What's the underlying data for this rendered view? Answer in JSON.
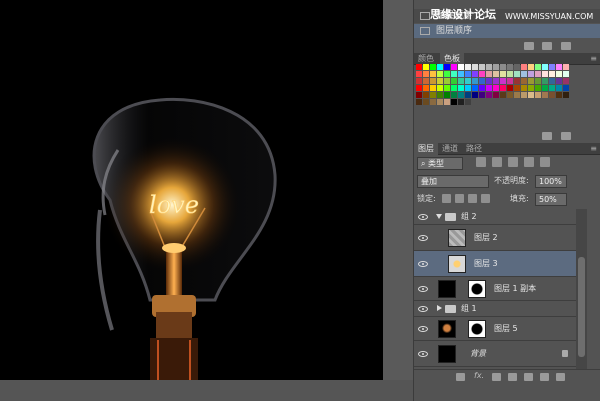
{
  "canvas": {
    "title_fragment": "",
    "bulb_text": "love"
  },
  "history_panel": {
    "items": [
      {
        "label": "图层顺序"
      },
      {
        "label": "图层顺序"
      }
    ],
    "watermark": "思缘设计论坛",
    "watermark_url": "WWW.MISSYUAN.COM"
  },
  "swatch_panel": {
    "tabs": [
      {
        "label": "颜色"
      },
      {
        "label": "色板"
      }
    ],
    "colors": [
      [
        "#ff0000",
        "#ffff00",
        "#00ff00",
        "#00ffff",
        "#0000ff",
        "#ff00ff",
        "#ffffff",
        "#f0f0f0",
        "#dcdcdc",
        "#c8c8c8",
        "#b4b4b4",
        "#a0a0a0",
        "#8c8c8c",
        "#787878",
        "#646464",
        "#ff8080",
        "#ffd080",
        "#80ff80",
        "#80ffff",
        "#8080ff",
        "#ff80ff",
        "#ffb0b0"
      ],
      [
        "#ff4040",
        "#ff8040",
        "#ffc040",
        "#c0ff40",
        "#40ff40",
        "#40ffc0",
        "#40c0ff",
        "#4080ff",
        "#8040ff",
        "#ff40c0",
        "#e0a0a0",
        "#e0c0a0",
        "#e0e0a0",
        "#c0e0a0",
        "#a0e0c0",
        "#a0c0e0",
        "#c0a0e0",
        "#e0a0c0",
        "#ffe0e0",
        "#fff0e0",
        "#f0ffe0",
        "#e0fff0"
      ],
      [
        "#cc3333",
        "#cc6633",
        "#cc9933",
        "#cccc33",
        "#99cc33",
        "#33cc33",
        "#33cc99",
        "#33cccc",
        "#3399cc",
        "#3366cc",
        "#6633cc",
        "#9933cc",
        "#cc33cc",
        "#cc3399",
        "#993333",
        "#996633",
        "#999933",
        "#669933",
        "#339966",
        "#336699",
        "#663399",
        "#993366"
      ],
      [
        "#ff0000",
        "#ff6600",
        "#ffcc00",
        "#ccff00",
        "#66ff00",
        "#00ff66",
        "#00ffcc",
        "#00ccff",
        "#0066ff",
        "#6600ff",
        "#cc00ff",
        "#ff00cc",
        "#ff0066",
        "#aa0000",
        "#aa4400",
        "#aa8800",
        "#88aa00",
        "#44aa00",
        "#00aa44",
        "#00aa88",
        "#0088aa",
        "#0044aa"
      ],
      [
        "#800000",
        "#804000",
        "#808000",
        "#408000",
        "#008000",
        "#008040",
        "#008080",
        "#004080",
        "#000080",
        "#400080",
        "#800080",
        "#800040",
        "#5a3a1a",
        "#7a5a2a",
        "#9a7a4a",
        "#ba9a6a",
        "#dabb8a",
        "#c8a070",
        "#a07850",
        "#785030",
        "#503010",
        "#302010"
      ],
      [
        "#4a2a10",
        "#6a4a20",
        "#8a6a40",
        "#aa8a60",
        "#caa080",
        "#000000",
        "#202020",
        "#404040"
      ]
    ]
  },
  "layers_panel": {
    "tabs": [
      {
        "label": "图层"
      },
      {
        "label": "通道"
      },
      {
        "label": "路径"
      }
    ],
    "filter_kind": "类型",
    "blend_mode": "叠加",
    "opacity_label": "不透明度:",
    "opacity_value": "100%",
    "lock_label": "锁定:",
    "fill_label": "填充:",
    "fill_value": "50%",
    "layers": [
      {
        "name": "组 2",
        "type": "group",
        "expanded": true
      },
      {
        "name": "图层 2",
        "type": "layer"
      },
      {
        "name": "图层 3",
        "type": "layer",
        "selected": true
      },
      {
        "name": "图层 1 副本",
        "type": "masked"
      },
      {
        "name": "组 1",
        "type": "group",
        "expanded": false
      },
      {
        "name": "图层 5",
        "type": "masked"
      },
      {
        "name": "背景",
        "type": "background"
      }
    ],
    "bottom_fx": "fx."
  }
}
